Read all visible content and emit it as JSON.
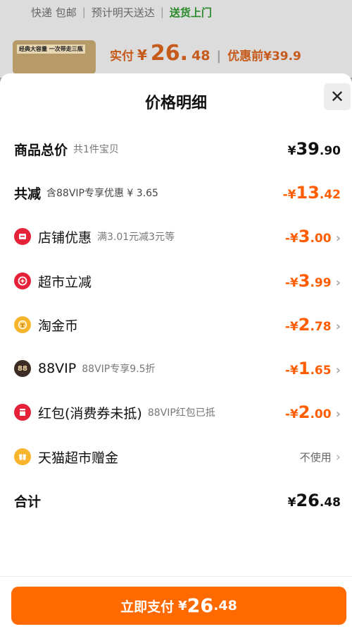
{
  "background": {
    "shipping_label": "快递 包邮",
    "delivery_label": "预计明天送达",
    "delivery_highlight": "送货上门",
    "product_label": "经典大容量 一次带走三瓶",
    "price_label": "实付",
    "price_currency": "¥",
    "price_int": "26.",
    "price_dec": "48",
    "original_price": "优惠前¥39.9"
  },
  "sheet": {
    "title": "价格明细",
    "close_icon": "close-icon"
  },
  "summary": {
    "total": {
      "name": "商品总价",
      "note": "共1件宝贝",
      "currency": "¥",
      "int": "39",
      "dec": ".90"
    },
    "discount": {
      "name": "共减",
      "note": "含88VIP专享优惠 ¥ 3.65",
      "sign": "-¥",
      "int": "13",
      "dec": ".42"
    }
  },
  "items": [
    {
      "icon": "store-discount-icon",
      "label": "店铺优惠",
      "note": "满3.01元减3元等",
      "sign": "-¥",
      "int": "3",
      "dec": ".00",
      "chevron": "›"
    },
    {
      "icon": "supermarket-icon",
      "label": "超市立减",
      "note": "",
      "sign": "-¥",
      "int": "3",
      "dec": ".99",
      "chevron": "›"
    },
    {
      "icon": "gold-coin-icon",
      "label": "淘金币",
      "note": "",
      "sign": "-¥",
      "int": "2",
      "dec": ".78",
      "chevron": "›"
    },
    {
      "icon": "88vip-icon",
      "label": "88VIP",
      "note": "88VIP专享9.5折",
      "sign": "-¥",
      "int": "1",
      "dec": ".65",
      "chevron": "›"
    },
    {
      "icon": "red-packet-icon",
      "label": "红包(消费券未抵)",
      "note": "88VIP红包已抵",
      "sign": "-¥",
      "int": "2",
      "dec": ".00",
      "chevron": "›"
    },
    {
      "icon": "gift-credit-icon",
      "label": "天猫超市赠金",
      "note": "",
      "status": "不使用",
      "chevron": "›"
    }
  ],
  "grand_total": {
    "name": "合计",
    "currency": "¥",
    "int": "26",
    "dec": ".48"
  },
  "pay_button": {
    "label": "立即支付",
    "currency": "¥",
    "int": "26",
    "dec": ".48"
  },
  "colors": {
    "accent": "#ff6a00",
    "discount_text": "#ff5d00",
    "delivery_green": "#2a8a2a"
  }
}
